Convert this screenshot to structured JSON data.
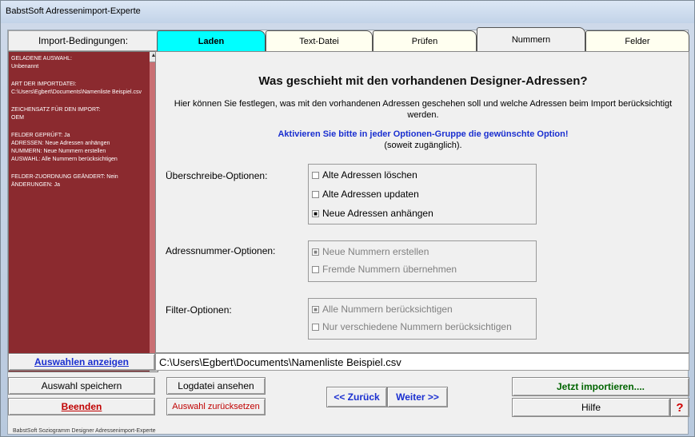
{
  "window": {
    "title": "BabstSoft Adressenimport-Experte"
  },
  "left": {
    "header": "Import-Bedingungen:",
    "info": {
      "sel_label": "Geladene Auswahl:",
      "sel_value": "Unbenannt",
      "art_label": "Art der Importdatei:",
      "art_value": "C:\\Users\\Egbert\\Documents\\Namenliste Beispiel.csv",
      "zs_label": "Zeichensatz für den Import:",
      "zs_value": "OEM",
      "line1": "FELDER GEPRÜFT: Ja",
      "line2": "ADRESSEN: Neue Adressen anhängen",
      "line3": "NUMMERN: Neue Nummern erstellen",
      "line4": "AUSWAHL: Alle Nummern berücksichtigen",
      "line5": "FELDER-ZUORDNUNG GEÄNDERT: Nein",
      "line6": "ÄNDERUNGEN: Ja"
    }
  },
  "tabs": [
    "Laden",
    "Text-Datei",
    "Prüfen",
    "Nummern",
    "Felder"
  ],
  "panel": {
    "heading": "Was geschieht mit den vorhandenen Designer-Adressen?",
    "description": "Hier können Sie festlegen, was mit den vorhandenen Adressen geschehen soll und welche Adressen beim Import berücksichtigt werden.",
    "instruction": "Aktivieren Sie bitte in jeder Optionen-Gruppe die gewünschte Option!",
    "instruction_note": "(soweit zugänglich).",
    "groups": {
      "overwrite": {
        "label": "Überschreibe-Optionen:",
        "options": [
          "Alte Adressen löschen",
          "Alte Adressen updaten",
          "Neue Adressen anhängen"
        ]
      },
      "number": {
        "label": "Adressnummer-Optionen:",
        "options": [
          "Neue Nummern erstellen",
          "Fremde Nummern übernehmen"
        ]
      },
      "filter": {
        "label": "Filter-Optionen:",
        "options": [
          "Alle Nummern berücksichtigen",
          "Nur verschiedene Nummern berücksichtigen"
        ]
      }
    }
  },
  "path_value": "C:\\Users\\Egbert\\Documents\\Namenliste Beispiel.csv",
  "buttons": {
    "show_selection": "Auswahlen anzeigen",
    "save_selection": "Auswahl speichern",
    "quit": "Beenden",
    "view_log": "Logdatei ansehen",
    "reset_selection": "Auswahl zurücksetzen",
    "back": "<< Zurück",
    "next": "Weiter >>",
    "import_now": "Jetzt importieren....",
    "help": "Hilfe",
    "help_icon_glyph": "?"
  },
  "status_text": "BabstSoft Soziogramm Designer Adressenimport-Experte",
  "colors": {
    "info_bg": "#8b2a2f",
    "tab_active": "#00ffff",
    "link_blue": "#1a2fd0",
    "quit_red": "#c00000",
    "import_green": "#006400"
  }
}
